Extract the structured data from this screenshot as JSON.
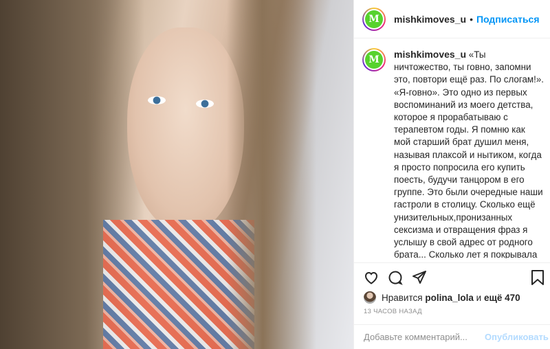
{
  "post": {
    "username": "mishkimoves_u",
    "avatar_letter": "M",
    "follow_label": "Подписаться",
    "caption": "«Ты ничтожество, ты говно, запомни это, повтори ещё раз. По слогам!». «Я-говно». Это одно из первых воспоминаний из моего детства, которое я прорабатываю с терапевтом годы. Я помню как мой старший брат душил меня, называя плаксой и нытиком, когда я просто попросила его купить поесть, будучи танцором в его группе. Это были очередные наши гастроли в столицу. Сколько ещё унизительных,пронизанных сексизма и отвращения фраз я услышу в свой адрес от родного брата... Сколько лет я покрывала его жестокость, насилие, его издевательства... сколько лет я мчалась к нему, как к самому"
  },
  "actions": {
    "icons": [
      "heart-icon",
      "comment-icon",
      "share-icon",
      "bookmark-icon"
    ]
  },
  "likes": {
    "prefix": "Нравится",
    "user": "polina_lola",
    "middle": "и",
    "others": "ещё 470"
  },
  "time": "13 ЧАСОВ НАЗАД",
  "comment": {
    "placeholder": "Добавьте комментарий...",
    "publish_label": "Опубликовать"
  },
  "colors": {
    "accent": "#0095f6",
    "publish_disabled": "#b3dbff",
    "avatar_green": "#57d22d"
  }
}
